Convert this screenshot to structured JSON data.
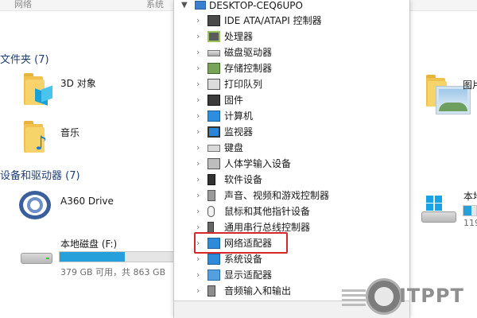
{
  "explorer": {
    "toolbar": {
      "left_label": "网络",
      "right_label": "系统"
    },
    "folders_section": "文件夹 (7)",
    "devices_section": "设备和驱动器 (7)",
    "items": [
      {
        "name": "3D 对象"
      },
      {
        "name": "音乐"
      },
      {
        "name": "图片"
      },
      {
        "name": "A360 Drive"
      },
      {
        "name": "本地磁盘 (F:)",
        "free_text": "379 GB 可用，共 863 GB",
        "usage_fraction": 0.56
      },
      {
        "name": "本地",
        "free_text": "119"
      }
    ]
  },
  "device_manager": {
    "root": "DESKTOP-CEQ6UPO",
    "categories": [
      {
        "label": "IDE ATA/ATAPI 控制器",
        "icon": "ide-controller-icon"
      },
      {
        "label": "处理器",
        "icon": "processor-icon"
      },
      {
        "label": "磁盘驱动器",
        "icon": "disk-drive-icon"
      },
      {
        "label": "存储控制器",
        "icon": "storage-controller-icon"
      },
      {
        "label": "打印队列",
        "icon": "printer-icon"
      },
      {
        "label": "固件",
        "icon": "firmware-icon"
      },
      {
        "label": "计算机",
        "icon": "computer-icon"
      },
      {
        "label": "监视器",
        "icon": "monitor-icon"
      },
      {
        "label": "键盘",
        "icon": "keyboard-icon"
      },
      {
        "label": "人体学输入设备",
        "icon": "hid-icon"
      },
      {
        "label": "软件设备",
        "icon": "software-device-icon"
      },
      {
        "label": "声音、视频和游戏控制器",
        "icon": "audio-icon"
      },
      {
        "label": "鼠标和其他指针设备",
        "icon": "mouse-icon"
      },
      {
        "label": "通用串行总线控制器",
        "icon": "usb-icon"
      },
      {
        "label": "网络适配器",
        "icon": "network-adapter-icon",
        "highlighted": true
      },
      {
        "label": "系统设备",
        "icon": "system-device-icon"
      },
      {
        "label": "显示适配器",
        "icon": "display-adapter-icon"
      },
      {
        "label": "音频输入和输出",
        "icon": "audio-io-icon"
      }
    ]
  },
  "watermark": {
    "text": "ITPPT"
  }
}
